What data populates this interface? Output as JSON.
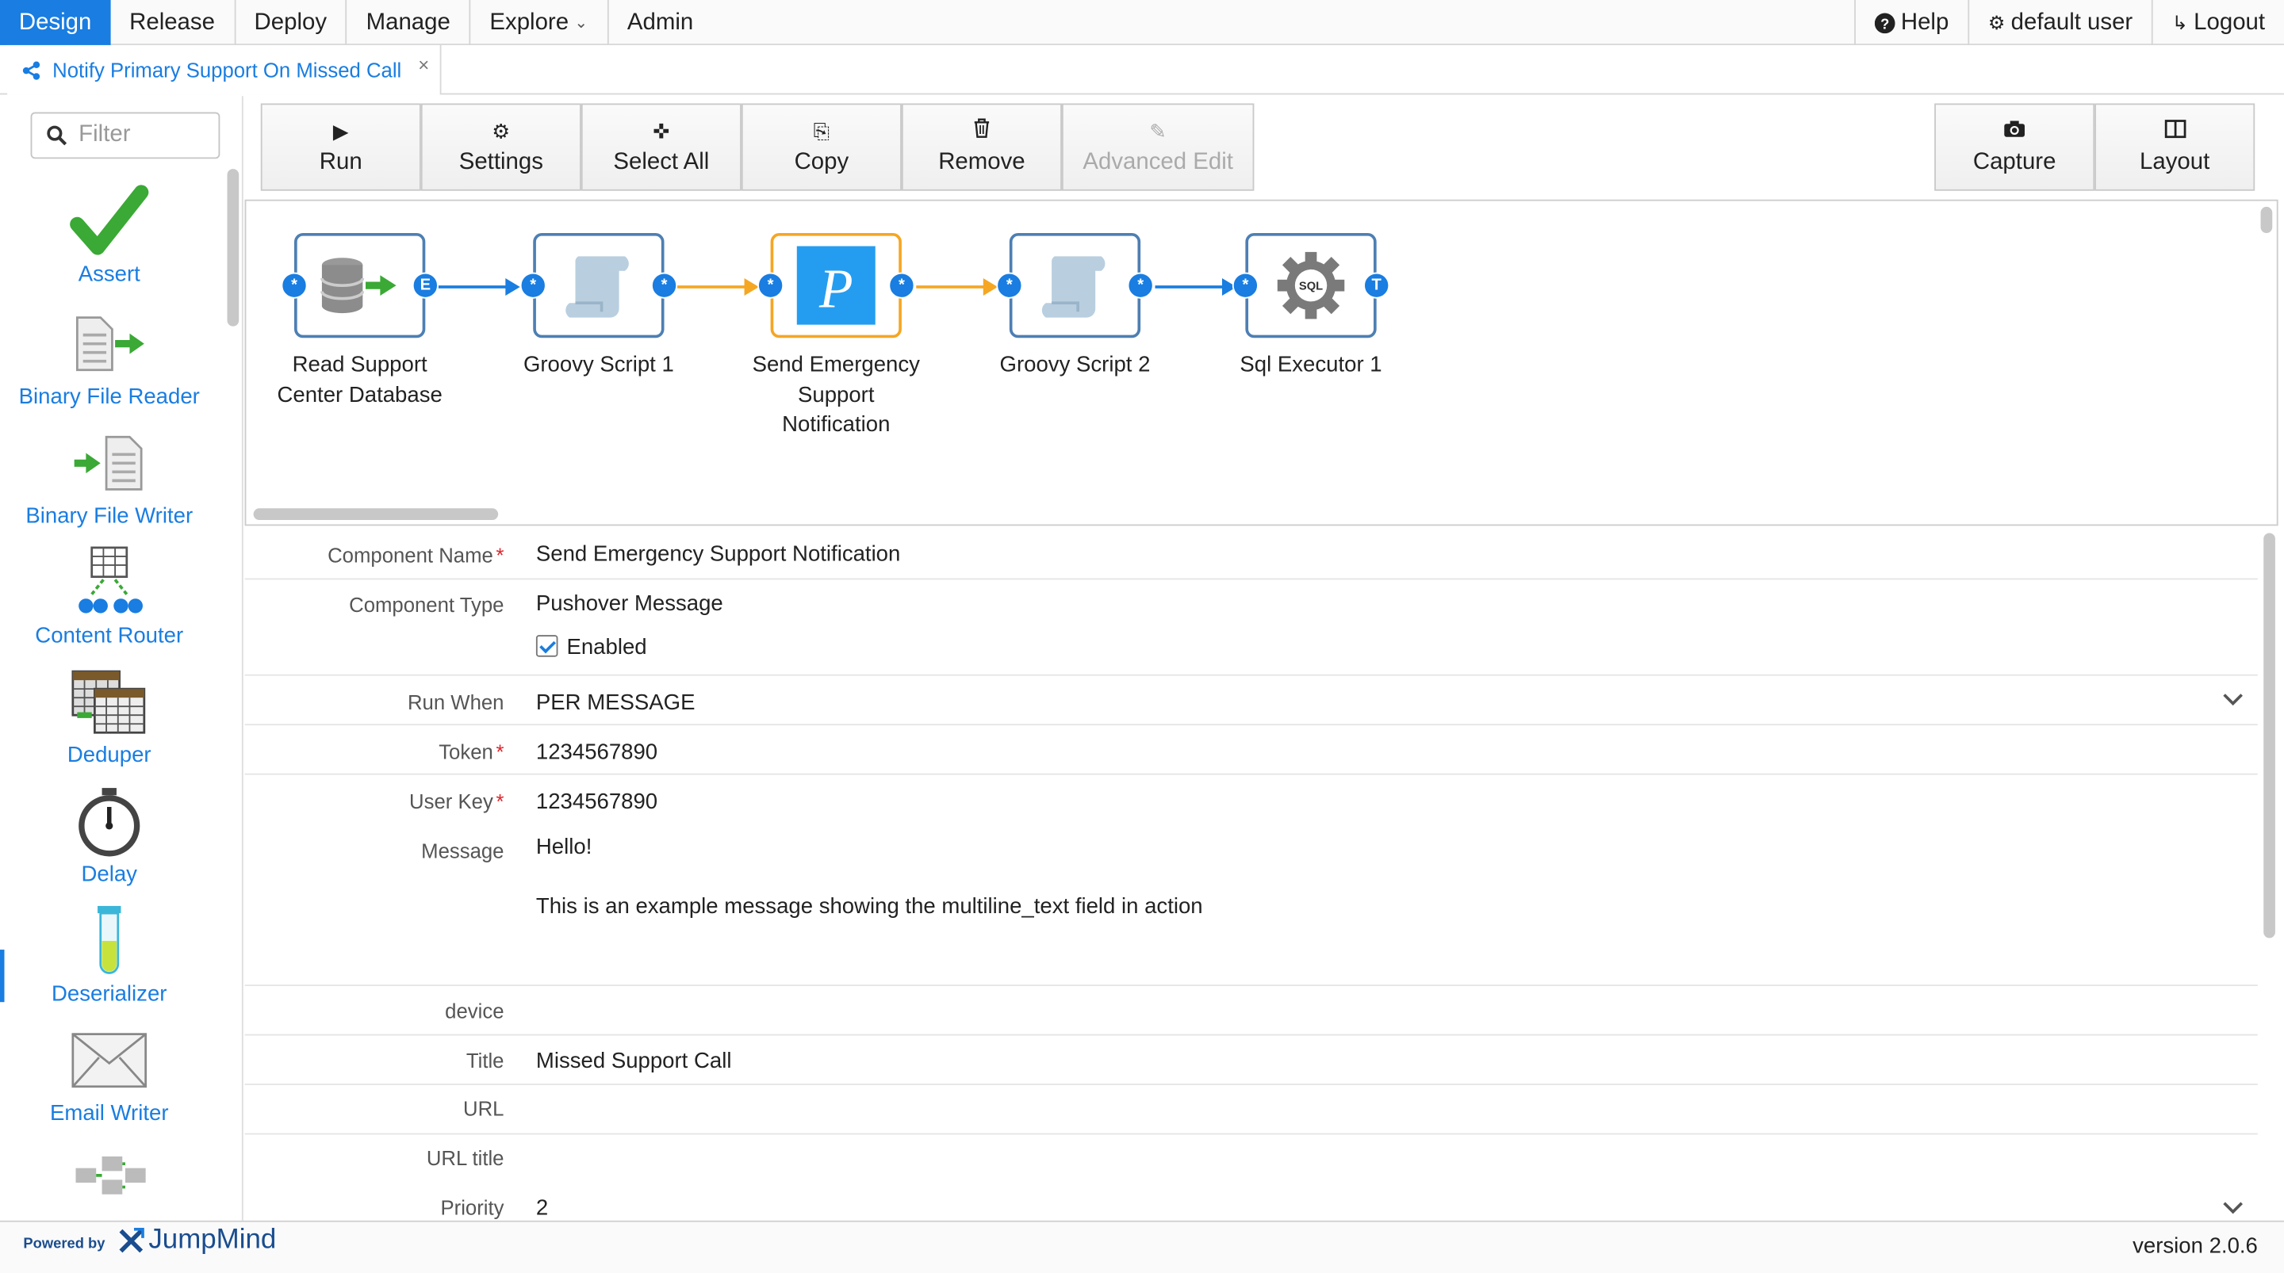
{
  "menu": {
    "items": [
      {
        "label": "Design",
        "active": true
      },
      {
        "label": "Release"
      },
      {
        "label": "Deploy"
      },
      {
        "label": "Manage"
      },
      {
        "label": "Explore",
        "dropdown": true
      },
      {
        "label": "Admin"
      }
    ],
    "help": "Help",
    "user": "default user",
    "logout": "Logout"
  },
  "tab": {
    "title": "Notify Primary Support On Missed Call",
    "close": "×"
  },
  "palette": {
    "filter_placeholder": "Filter",
    "items": [
      {
        "label": "Assert",
        "icon": "check-icon"
      },
      {
        "label": "Binary File Reader",
        "icon": "file-reader-icon"
      },
      {
        "label": "Binary File Writer",
        "icon": "file-writer-icon"
      },
      {
        "label": "Content Router",
        "icon": "router-icon"
      },
      {
        "label": "Deduper",
        "icon": "deduper-icon"
      },
      {
        "label": "Delay",
        "icon": "stopwatch-icon"
      },
      {
        "label": "Deserializer",
        "icon": "test-tube-icon"
      },
      {
        "label": "Email Writer",
        "icon": "envelope-icon"
      }
    ]
  },
  "toolbar": {
    "run": "Run",
    "settings": "Settings",
    "select_all": "Select All",
    "copy": "Copy",
    "remove": "Remove",
    "advanced_edit": "Advanced Edit",
    "capture": "Capture",
    "layout": "Layout"
  },
  "flow": {
    "nodes": [
      {
        "label_lines": [
          "Read Support",
          "Center Database"
        ],
        "in": "*",
        "out": "E"
      },
      {
        "label_lines": [
          "Groovy Script 1"
        ],
        "in": "*",
        "out": "*"
      },
      {
        "label_lines": [
          "Send Emergency",
          "Support",
          "Notification"
        ],
        "in": "*",
        "out": "*",
        "selected": true
      },
      {
        "label_lines": [
          "Groovy Script 2"
        ],
        "in": "*",
        "out": "*"
      },
      {
        "label_lines": [
          "Sql Executor 1"
        ],
        "in": "*",
        "out": "T"
      }
    ],
    "colors": {
      "link": "#197de1",
      "selected_link": "#f5a623"
    }
  },
  "properties": {
    "component_name": {
      "label": "Component Name",
      "value": "Send Emergency Support Notification",
      "required": "*"
    },
    "component_type": {
      "label": "Component Type",
      "value": "Pushover Message"
    },
    "enabled": {
      "label": "Enabled",
      "checked": true
    },
    "run_when": {
      "label": "Run When",
      "value": "PER MESSAGE"
    },
    "token": {
      "label": "Token",
      "value": "1234567890",
      "required": "*"
    },
    "user_key": {
      "label": "User Key",
      "value": "1234567890",
      "required": "*"
    },
    "message": {
      "label": "Message",
      "line1": "Hello!",
      "line2": "This is an example message showing the multiline_text field in action"
    },
    "device": {
      "label": "device",
      "value": ""
    },
    "title": {
      "label": "Title",
      "value": "Missed Support Call"
    },
    "url": {
      "label": "URL",
      "value": ""
    },
    "url_title": {
      "label": "URL title",
      "value": ""
    },
    "priority": {
      "label": "Priority",
      "value": "2"
    }
  },
  "footer": {
    "powered": "Powered by",
    "brand": "JumpMind",
    "version": "version 2.0.6"
  },
  "colors": {
    "accent": "#197de1",
    "selected": "#f5a623",
    "required": "#e0242b"
  }
}
